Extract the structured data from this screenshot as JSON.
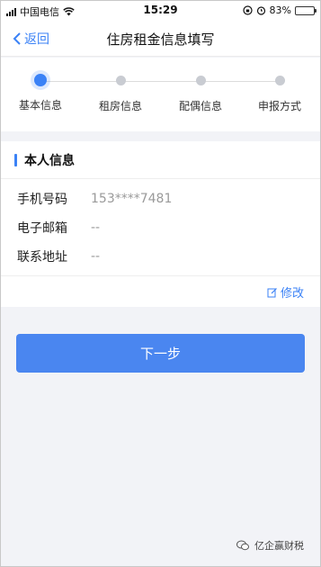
{
  "status_bar": {
    "carrier": "中国电信",
    "time": "15:29",
    "battery": "83%",
    "battery_level": 0.83
  },
  "nav": {
    "back_label": "返回",
    "title": "住房租金信息填写"
  },
  "steps": [
    {
      "label": "基本信息",
      "active": true
    },
    {
      "label": "租房信息",
      "active": false
    },
    {
      "label": "配偶信息",
      "active": false
    },
    {
      "label": "申报方式",
      "active": false
    }
  ],
  "section": {
    "title": "本人信息",
    "fields": [
      {
        "label": "手机号码",
        "value": "153****7481"
      },
      {
        "label": "电子邮箱",
        "value": "--"
      },
      {
        "label": "联系地址",
        "value": "--"
      }
    ],
    "edit_label": "修改"
  },
  "next_button": "下一步",
  "watermark": "亿企赢财税",
  "colors": {
    "accent": "#3b82f6",
    "button": "#4a86f0",
    "background": "#f2f3f7"
  }
}
